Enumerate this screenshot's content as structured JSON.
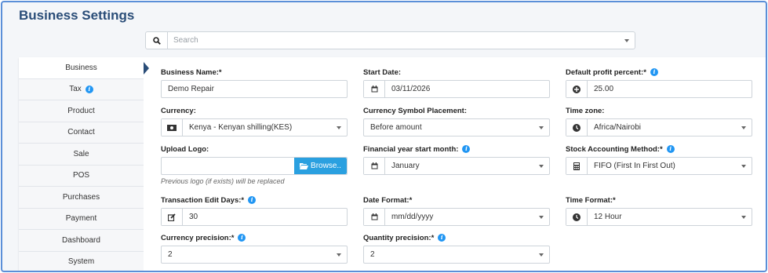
{
  "page_title": "Business Settings",
  "search": {
    "placeholder": "Search"
  },
  "sidebar": {
    "items": [
      {
        "label": "Business"
      },
      {
        "label": "Tax"
      },
      {
        "label": "Product"
      },
      {
        "label": "Contact"
      },
      {
        "label": "Sale"
      },
      {
        "label": "POS"
      },
      {
        "label": "Purchases"
      },
      {
        "label": "Payment"
      },
      {
        "label": "Dashboard"
      },
      {
        "label": "System"
      }
    ]
  },
  "form": {
    "business_name": {
      "label": "Business Name:*",
      "value": "Demo Repair"
    },
    "start_date": {
      "label": "Start Date:",
      "value": "03/11/2026"
    },
    "default_profit": {
      "label": "Default profit percent:*",
      "value": "25.00"
    },
    "currency": {
      "label": "Currency:",
      "value": "Kenya - Kenyan shilling(KES)"
    },
    "symbol_placement": {
      "label": "Currency Symbol Placement:",
      "value": "Before amount"
    },
    "time_zone": {
      "label": "Time zone:",
      "value": "Africa/Nairobi"
    },
    "upload_logo": {
      "label": "Upload Logo:",
      "button": "Browse..",
      "help": "Previous logo (if exists) will be replaced"
    },
    "fy_start": {
      "label": "Financial year start month:",
      "value": "January"
    },
    "stock_method": {
      "label": "Stock Accounting Method:*",
      "value": "FIFO (First In First Out)"
    },
    "edit_days": {
      "label": "Transaction Edit Days:*",
      "value": "30"
    },
    "date_format": {
      "label": "Date Format:*",
      "value": "mm/dd/yyyy"
    },
    "time_format": {
      "label": "Time Format:*",
      "value": "12 Hour"
    },
    "currency_precision": {
      "label": "Currency precision:*",
      "value": "2"
    },
    "quantity_precision": {
      "label": "Quantity precision:*",
      "value": "2"
    }
  },
  "colors": {
    "title": "#2a4d78",
    "accent": "#2aa0e0",
    "info": "#2196f3"
  }
}
